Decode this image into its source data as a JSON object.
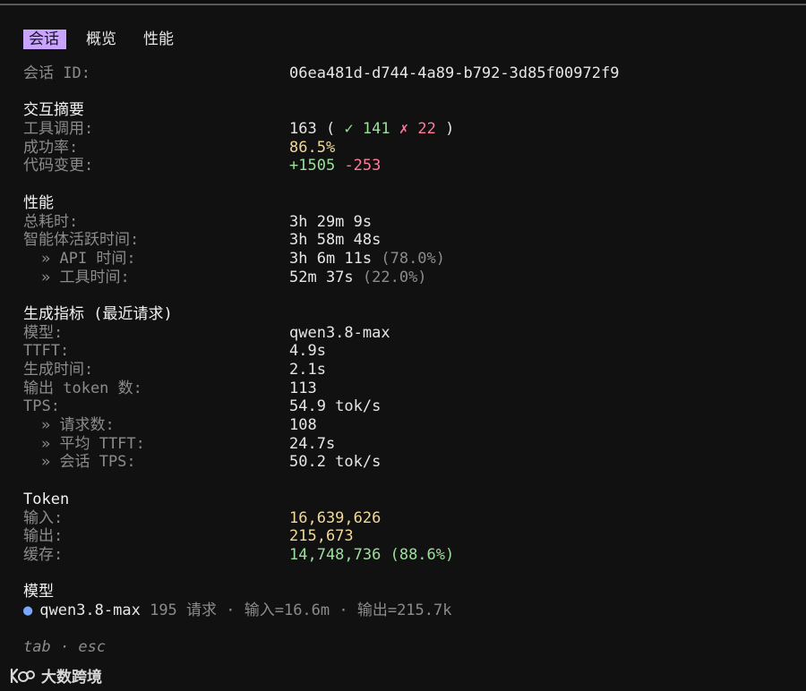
{
  "tabs": [
    {
      "label": "会话",
      "active": true
    },
    {
      "label": "概览",
      "active": false
    },
    {
      "label": "性能",
      "active": false
    }
  ],
  "session": {
    "label": "会话 ID:",
    "value": "06ea481d-d744-4a89-b792-3d85f00972f9"
  },
  "interaction": {
    "heading": "交互摘要",
    "tool_calls_label": "工具调用:",
    "tool_calls_total": "163",
    "tool_calls_open": " ( ",
    "tool_calls_ok": "✓ 141",
    "tool_calls_fail": "✗ 22",
    "tool_calls_close": " )",
    "success_label": "成功率:",
    "success_value": "86.5%",
    "code_label": "代码变更:",
    "code_added": "+1505",
    "code_removed": "-253"
  },
  "performance": {
    "heading": "性能",
    "total_label": "总耗时:",
    "total_value": "3h 29m 9s",
    "agent_label": "智能体活跃时间:",
    "agent_value": "3h 58m 48s",
    "api_label": "» API 时间:",
    "api_value": "3h 6m 11s",
    "api_pct": " (78.0%)",
    "tool_label": "» 工具时间:",
    "tool_value": "52m 37s",
    "tool_pct": " (22.0%)"
  },
  "generation": {
    "heading": "生成指标 (最近请求)",
    "model_label": "模型:",
    "model_value": "qwen3.8-max",
    "ttft_label": "TTFT:",
    "ttft_value": "4.9s",
    "gen_time_label": "生成时间:",
    "gen_time_value": "2.1s",
    "output_tokens_label": "输出 token 数:",
    "output_tokens_value": "113",
    "tps_label": "TPS:",
    "tps_value": "54.9 tok/s",
    "requests_label": "» 请求数:",
    "requests_value": "108",
    "avg_ttft_label": "» 平均 TTFT:",
    "avg_ttft_value": "24.7s",
    "session_tps_label": "» 会话 TPS:",
    "session_tps_value": "50.2 tok/s"
  },
  "token": {
    "heading": "Token",
    "input_label": "输入:",
    "input_value": "16,639,626",
    "output_label": "输出:",
    "output_value": "215,673",
    "cache_label": "缓存:",
    "cache_value": "14,748,736",
    "cache_pct": " (88.6%)"
  },
  "models": {
    "heading": "模型",
    "items": [
      {
        "name": "qwen3.8-max",
        "detail": " 195 请求 · 输入=16.6m · 输出=215.7k"
      }
    ]
  },
  "footer": {
    "hint": "tab · esc"
  },
  "watermark": {
    "text": "大数跨境"
  },
  "colors": {
    "accent_tab": "#c9a4ff",
    "success": "#9be09b",
    "error": "#ff7a9a",
    "highlight": "#f1d99a",
    "model_dot": "#7aa8ff"
  }
}
